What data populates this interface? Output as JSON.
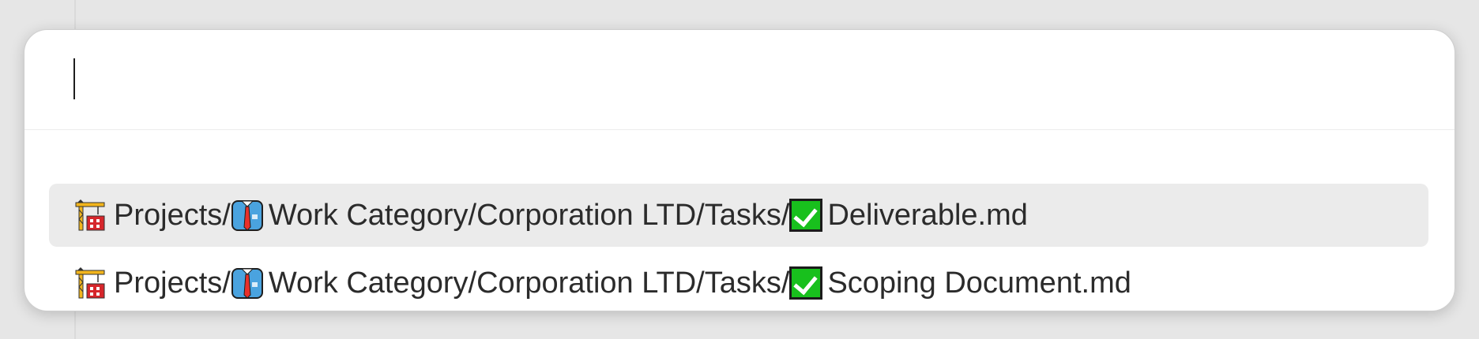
{
  "search": {
    "value": "",
    "placeholder": ""
  },
  "results": [
    {
      "segments": [
        {
          "icon": "construction-crane-icon",
          "text": "Projects/"
        },
        {
          "icon": "shirt-tie-icon",
          "text": " Work Category/Corporation LTD/Tasks/"
        },
        {
          "icon": "check-box-icon",
          "text": " Deliverable.md"
        }
      ],
      "selected": true
    },
    {
      "segments": [
        {
          "icon": "construction-crane-icon",
          "text": "Projects/"
        },
        {
          "icon": "shirt-tie-icon",
          "text": " Work Category/Corporation LTD/Tasks/"
        },
        {
          "icon": "check-box-icon",
          "text": " Scoping Document.md"
        }
      ],
      "selected": false
    }
  ],
  "colors": {
    "selected_row": "#ebebeb",
    "check_green": "#18c01d"
  }
}
